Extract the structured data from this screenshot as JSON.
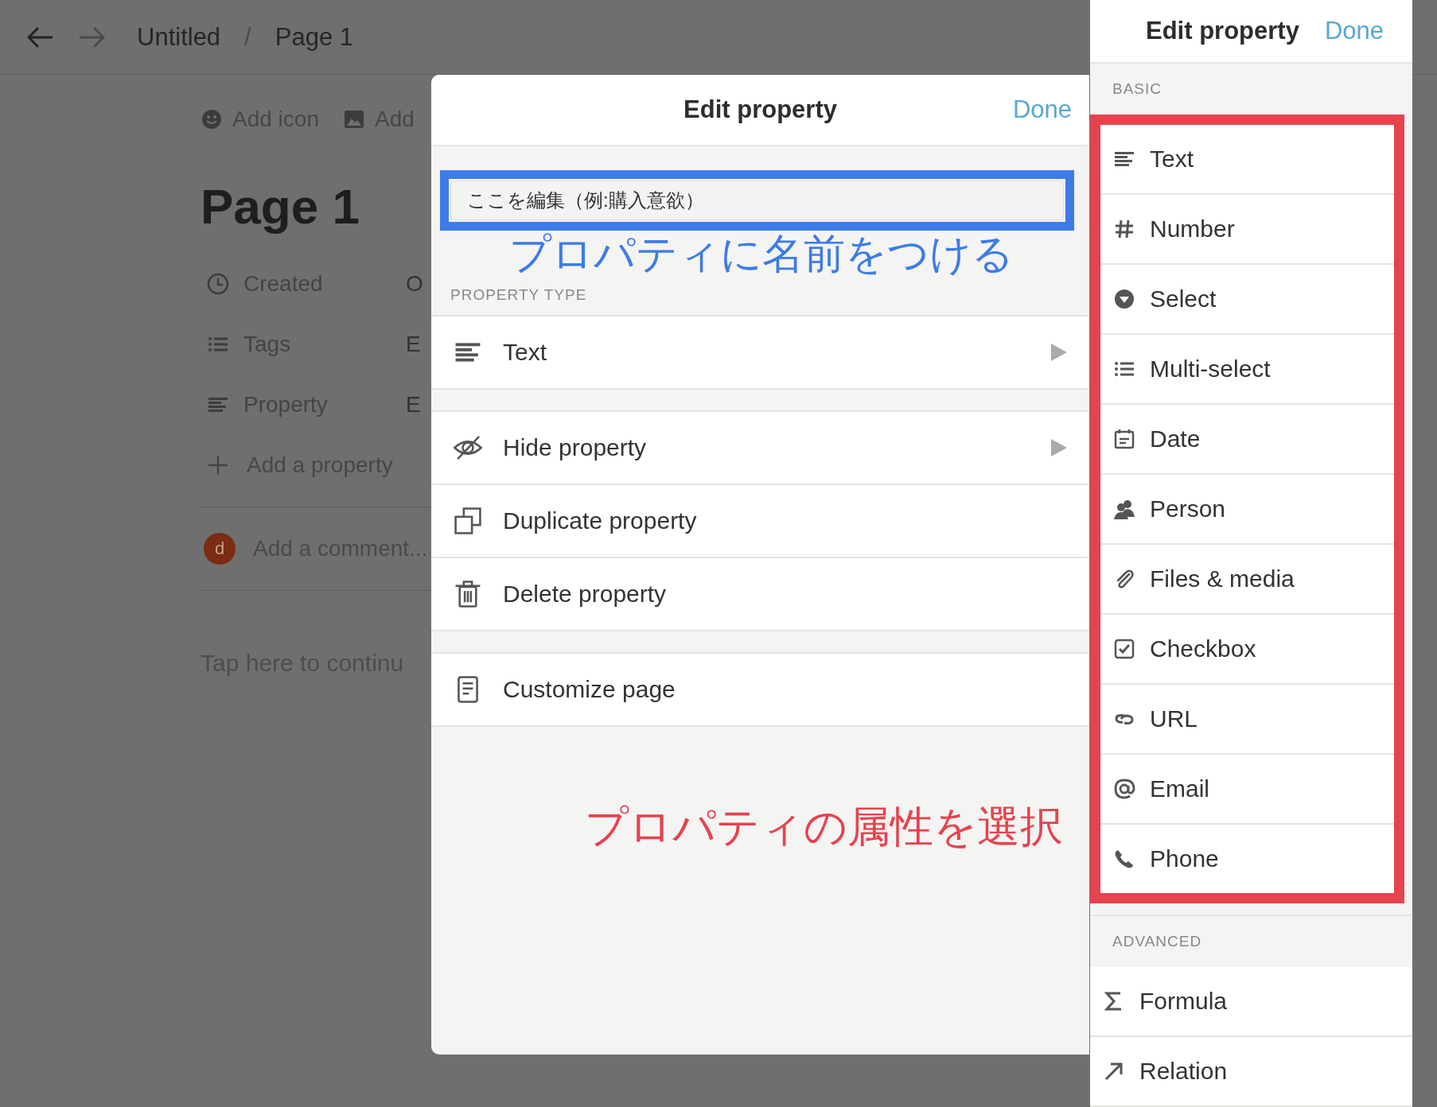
{
  "top_bar": {
    "breadcrumbs": [
      "Untitled",
      "Page 1"
    ],
    "separator": "/"
  },
  "page": {
    "actions": [
      {
        "kind": "emoji",
        "label": "Add icon"
      },
      {
        "kind": "image",
        "label": "Add"
      }
    ],
    "title": "Page 1",
    "properties": [
      {
        "kind": "clock",
        "name": "Created",
        "value": "O"
      },
      {
        "kind": "list",
        "name": "Tags",
        "value": "E"
      },
      {
        "kind": "text",
        "name": "Property",
        "value": "E"
      }
    ],
    "add_property": "Add a property",
    "comment": {
      "avatar": "d",
      "placeholder": "Add a comment..."
    },
    "body_hint": "Tap here to continu"
  },
  "edit_dialog": {
    "title": "Edit property",
    "done": "Done",
    "name_field": {
      "value": "ここを編集（例:購入意欲）"
    },
    "type_label": "PROPERTY TYPE",
    "type": {
      "kind": "text",
      "label": "Text",
      "submenu": true
    },
    "actions": [
      {
        "kind": "hide",
        "label": "Hide property",
        "submenu": true
      },
      {
        "kind": "duplicate",
        "label": "Duplicate property",
        "submenu": false
      },
      {
        "kind": "delete",
        "label": "Delete property",
        "submenu": false
      }
    ],
    "page_actions": [
      {
        "kind": "customize",
        "label": "Customize page",
        "submenu": false
      }
    ]
  },
  "type_panel": {
    "title": "Edit property",
    "done": "Done",
    "sections": [
      {
        "label": "BASIC",
        "items": [
          {
            "kind": "text",
            "label": "Text"
          },
          {
            "kind": "number",
            "label": "Number"
          },
          {
            "kind": "select",
            "label": "Select"
          },
          {
            "kind": "multiselect",
            "label": "Multi-select"
          },
          {
            "kind": "date",
            "label": "Date"
          },
          {
            "kind": "person",
            "label": "Person"
          },
          {
            "kind": "files",
            "label": "Files & media"
          },
          {
            "kind": "checkbox",
            "label": "Checkbox"
          },
          {
            "kind": "url",
            "label": "URL"
          },
          {
            "kind": "email",
            "label": "Email"
          },
          {
            "kind": "phone",
            "label": "Phone"
          }
        ]
      },
      {
        "label": "ADVANCED",
        "items": [
          {
            "kind": "formula",
            "label": "Formula"
          },
          {
            "kind": "relation",
            "label": "Relation"
          }
        ]
      }
    ]
  },
  "annotations": [
    {
      "kind": "name_hint",
      "text": "プロパティに名前をつける",
      "color": "#3d7be8"
    },
    {
      "kind": "type_hint",
      "text": "プロパティの属性を選択",
      "color": "#e5434e"
    }
  ]
}
